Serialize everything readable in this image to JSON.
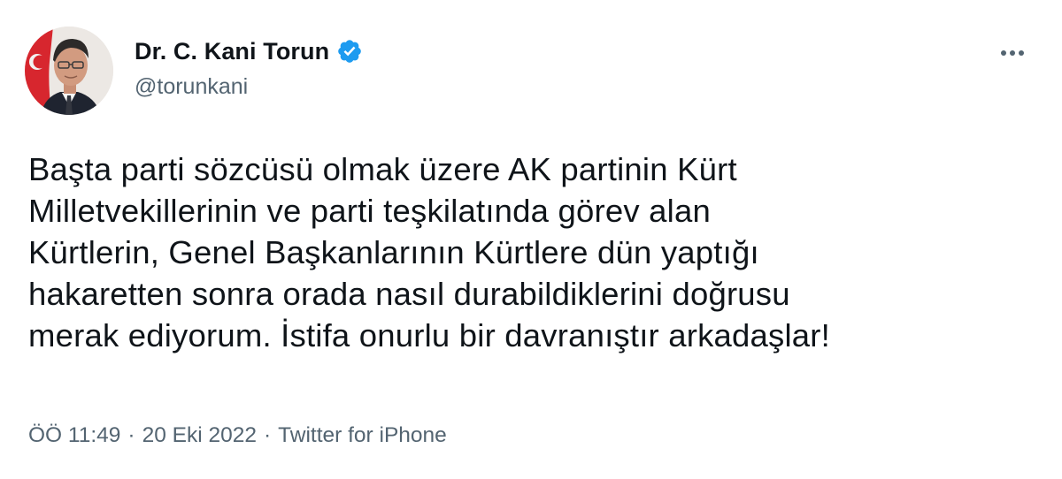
{
  "author": {
    "name": "Dr. C. Kani Torun",
    "handle": "@torunkani"
  },
  "tweet": {
    "text": "Başta parti sözcüsü olmak üzere AK partinin Kürt\nMilletvekillerinin ve parti teşkilatında görev alan\nKürtlerin, Genel Başkanlarının Kürtlere dün yaptığı\nhakaretten sonra orada nasıl durabildiklerini doğrusu\nmerak ediyorum. İstifa onurlu bir davranıştır arkadaşlar!"
  },
  "meta": {
    "time": "ÖÖ 11:49",
    "separator": "·",
    "date": "20 Eki 2022",
    "source": "Twitter for iPhone"
  },
  "icons": {
    "verified": "verified-badge-icon",
    "more": "more-options-icon"
  },
  "colors": {
    "verified_blue": "#1d9bf0",
    "text_primary": "#0f1419",
    "text_secondary": "#536471"
  }
}
